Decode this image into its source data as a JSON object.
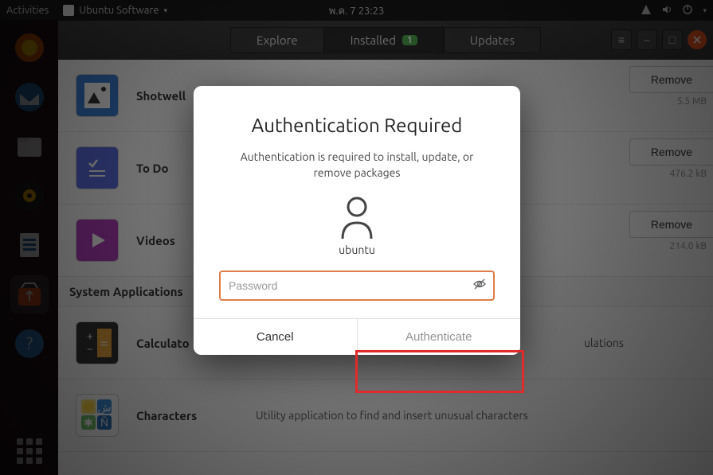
{
  "topbar": {
    "activities": "Activities",
    "appname": "Ubuntu Software",
    "clock": "พ.ค. 7  23:23"
  },
  "header": {
    "tabs": {
      "explore": "Explore",
      "installed": "Installed",
      "installed_badge": "1",
      "updates": "Updates"
    }
  },
  "list": {
    "items": [
      {
        "name": "Shotwell",
        "desc": "",
        "size": "5.5 MB",
        "remove": "Remove"
      },
      {
        "name": "To Do",
        "desc": "",
        "size": "476.2 kB",
        "remove": "Remove"
      },
      {
        "name": "Videos",
        "desc": "",
        "size": "214.0 kB",
        "remove": "Remove"
      }
    ],
    "section": "System Applications",
    "sysitems": [
      {
        "name": "Calculato",
        "desc": "ulations"
      },
      {
        "name": "Characters",
        "desc": "Utility application to find and insert unusual characters"
      }
    ]
  },
  "modal": {
    "title": "Authentication Required",
    "message": "Authentication is required to install, update, or remove packages",
    "username": "ubuntu",
    "password_placeholder": "Password",
    "cancel": "Cancel",
    "authenticate": "Authenticate"
  }
}
